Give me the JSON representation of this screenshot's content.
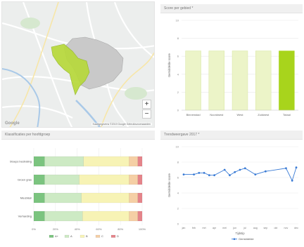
{
  "map": {
    "zoom_in_label": "+",
    "zoom_out_label": "−",
    "attribution": "Kaartgegevens ©2019 Google   Gebruiksvoorwaarden",
    "logo": "Google"
  },
  "score_panel": {
    "title": "Score per gebied *"
  },
  "cls_panel": {
    "title": "Klassificaties per hoofdgroep"
  },
  "trend_panel": {
    "title": "Trendweergave 2017 *"
  },
  "colors": {
    "bar_light": "#ecf4c8",
    "bar_light_border": "#d7e6a0",
    "bar_total": "#a8d41c",
    "line": "#3a7bd5",
    "map_highlight": "#b7d93b",
    "map_city": "#c9c9c9"
  },
  "chart_data": [
    {
      "id": "score",
      "type": "bar",
      "categories": [
        "Binnenstad",
        "Noordwest",
        "West",
        "Zuidwest",
        "Totaal"
      ],
      "values": [
        6.6,
        6.6,
        6.6,
        6.6,
        6.6
      ],
      "ylabel": "Gemiddelde score",
      "ylim": [
        0,
        10
      ],
      "yticks": [
        "10",
        "8",
        "6",
        "4",
        "2",
        "0"
      ]
    },
    {
      "id": "classifications",
      "type": "bar",
      "orientation": "horizontal-stacked",
      "categories": [
        "Stoeps bestrating",
        "Groen gras",
        "Meubilair",
        "Verharding"
      ],
      "series": [
        {
          "name": "A+",
          "color": "#7bc47f",
          "values": [
            10,
            10,
            10,
            10
          ]
        },
        {
          "name": "A",
          "color": "#cdeac4",
          "values": [
            36,
            32,
            34,
            35
          ]
        },
        {
          "name": "B",
          "color": "#f7f3b5",
          "values": [
            42,
            46,
            44,
            43
          ]
        },
        {
          "name": "C",
          "color": "#f5cfa5",
          "values": [
            8,
            8,
            8,
            8
          ]
        },
        {
          "name": "D",
          "color": "#e5848a",
          "values": [
            4,
            4,
            4,
            4
          ]
        }
      ],
      "xticks": [
        "0%",
        "20%",
        "40%",
        "60%",
        "80%",
        "100%"
      ]
    },
    {
      "id": "trend",
      "type": "line",
      "categories": [
        "jan",
        "feb",
        "mrt",
        "apr",
        "mei",
        "jun",
        "jul",
        "aug",
        "sep",
        "okt",
        "nov",
        "dec"
      ],
      "x_positions": [
        0,
        1,
        1.5,
        2,
        2.5,
        3,
        4,
        4.5,
        5,
        5.5,
        6,
        7,
        8,
        10,
        10.6,
        11
      ],
      "values": [
        6.4,
        6.4,
        6.6,
        6.6,
        6.3,
        6.3,
        7.0,
        6.3,
        6.7,
        7.0,
        7.2,
        6.4,
        6.8,
        7.2,
        5.6,
        7.3
      ],
      "ylabel": "Gemiddelde score",
      "xlabel": "Tijdstip",
      "legend": "Gemiddelde",
      "ylim": [
        0,
        10
      ],
      "yticks": [
        "10",
        "8",
        "6",
        "4",
        "2",
        "0"
      ]
    }
  ]
}
